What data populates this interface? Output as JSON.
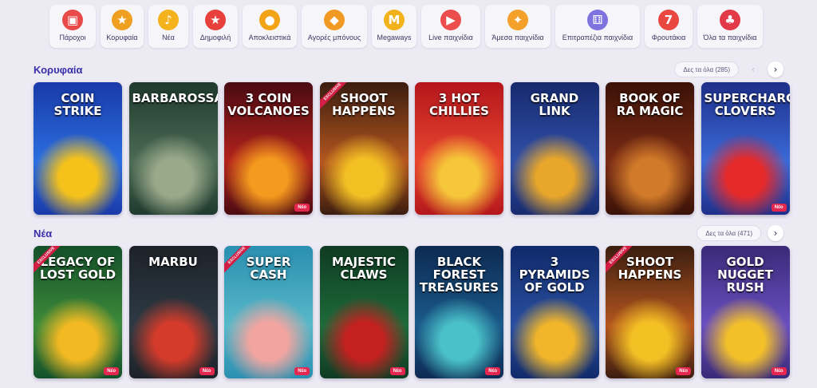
{
  "nav": [
    {
      "label": "Πάροχοι",
      "icon": "provider-icon",
      "glyph": "▣",
      "color": "#e84a4a",
      "width": 58
    },
    {
      "label": "Κορυφαία",
      "icon": "medal-icon",
      "glyph": "★",
      "color": "#f0a020",
      "width": 54
    },
    {
      "label": "Νέα",
      "icon": "bell-icon",
      "glyph": "♪",
      "color": "#f4b21d",
      "width": 50
    },
    {
      "label": "Δημοφιλή",
      "icon": "star-icon",
      "glyph": "★",
      "color": "#e8403a",
      "width": 56
    },
    {
      "label": "Αποκλειστικά",
      "icon": "coin-icon",
      "glyph": "●",
      "color": "#f3a416",
      "width": 68
    },
    {
      "label": "Αγορές μπόνους",
      "icon": "gift-icon",
      "glyph": "◆",
      "color": "#f19a23",
      "width": 82
    },
    {
      "label": "Megaways",
      "icon": "megaways-icon",
      "glyph": "M",
      "color": "#f2b21c",
      "width": 56
    },
    {
      "label": "Live παιχνίδια",
      "icon": "live-icon",
      "glyph": "▶",
      "color": "#ec4d4d",
      "width": 74
    },
    {
      "label": "Άμεσα παιχνίδια",
      "icon": "joystick-icon",
      "glyph": "✦",
      "color": "#f3a12a",
      "width": 82
    },
    {
      "label": "Επιτραπέζια παιχνίδια",
      "icon": "dice-icon",
      "glyph": "⚅",
      "color": "#7f73e0",
      "width": 106
    },
    {
      "label": "Φρουτάκια",
      "icon": "slot-machine-icon",
      "glyph": "7",
      "color": "#e9473f",
      "width": 60
    },
    {
      "label": "Όλα τα παιχνίδια",
      "icon": "cherries-icon",
      "glyph": "♣",
      "color": "#e33a4a",
      "width": 82
    }
  ],
  "sections": [
    {
      "title": "Κορυφαία",
      "see_all": "Δες τα όλα (285)",
      "games": [
        {
          "title": "Coin Strike",
          "badge": "",
          "ribbon": "",
          "c1": "#1a3aa8",
          "c2": "#2a6ee0",
          "c3": "#f5c21b"
        },
        {
          "title": "Barbarossa",
          "badge": "",
          "ribbon": "",
          "c1": "#1f3a2e",
          "c2": "#4c6b55",
          "c3": "#9aa98a"
        },
        {
          "title": "3 Coin Volcanoes",
          "badge": "Νέο",
          "ribbon": "",
          "c1": "#4a0b12",
          "c2": "#b3231c",
          "c3": "#f49a1e"
        },
        {
          "title": "Shoot Happens",
          "badge": "",
          "ribbon": "EXCLUSIVE",
          "c1": "#3b1d10",
          "c2": "#b4561f",
          "c3": "#f3c024"
        },
        {
          "title": "3 Hot Chillies",
          "badge": "",
          "ribbon": "",
          "c1": "#b4161c",
          "c2": "#e9462f",
          "c3": "#f6c73a"
        },
        {
          "title": "Grand Link",
          "badge": "",
          "ribbon": "",
          "c1": "#172a6e",
          "c2": "#3050a8",
          "c3": "#e8a62a"
        },
        {
          "title": "Book of Ra Magic",
          "badge": "",
          "ribbon": "",
          "c1": "#3b1208",
          "c2": "#7a2b14",
          "c3": "#d07a2a"
        },
        {
          "title": "Supercharged Clovers",
          "badge": "Νέο",
          "ribbon": "",
          "c1": "#1e2f8a",
          "c2": "#3b6ad8",
          "c3": "#e62a2a"
        }
      ]
    },
    {
      "title": "Νέα",
      "see_all": "Δες τα όλα (471)",
      "games": [
        {
          "title": "Legacy of Lost Gold",
          "badge": "Νέο",
          "ribbon": "EXCLUSIVE",
          "c1": "#14502a",
          "c2": "#3d8b3a",
          "c3": "#f2b922"
        },
        {
          "title": "Marbu",
          "badge": "Νέο",
          "ribbon": "",
          "c1": "#1d2228",
          "c2": "#2d3a44",
          "c3": "#d53b2a"
        },
        {
          "title": "Super Cash",
          "badge": "Νέο",
          "ribbon": "EXCLUSIVE",
          "c1": "#2a8fb0",
          "c2": "#58b9c9",
          "c3": "#f2a5a0"
        },
        {
          "title": "Majestic Claws",
          "badge": "Νέο",
          "ribbon": "",
          "c1": "#0f3b22",
          "c2": "#1d6b3a",
          "c3": "#c42020"
        },
        {
          "title": "Black Forest Treasures",
          "badge": "Νέο",
          "ribbon": "",
          "c1": "#0d2a52",
          "c2": "#1a5a8a",
          "c3": "#4ac0c8"
        },
        {
          "title": "3 Pyramids of Gold",
          "badge": "",
          "ribbon": "",
          "c1": "#102a6a",
          "c2": "#2a4fa0",
          "c3": "#f0b52a"
        },
        {
          "title": "Shoot Happens",
          "badge": "Νέο",
          "ribbon": "EXCLUSIVE",
          "c1": "#3b1d10",
          "c2": "#b4561f",
          "c3": "#f3c024"
        },
        {
          "title": "Gold Nugget Rush",
          "badge": "Νέο",
          "ribbon": "",
          "c1": "#3a2a78",
          "c2": "#6a4fc0",
          "c3": "#f3c02a"
        }
      ]
    }
  ]
}
